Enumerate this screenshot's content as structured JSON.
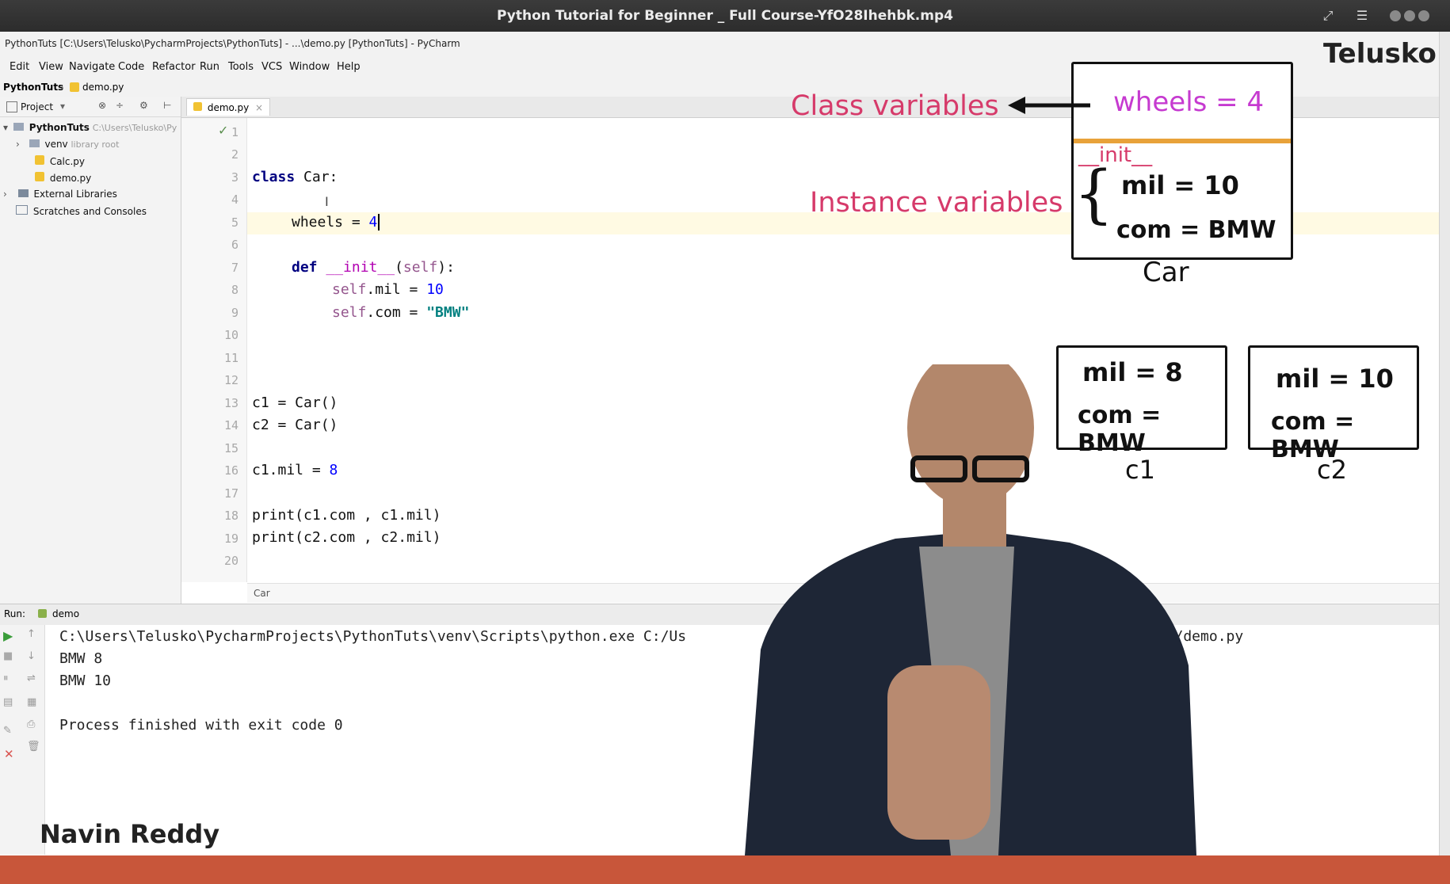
{
  "video": {
    "title": "Python Tutorial for Beginner _ Full Course-YfO28Ihehbk.mp4",
    "expand_icon": "expand-icon",
    "menu_icon": "hamburger-menu-icon"
  },
  "pycharm": {
    "window_title": "PythonTuts [C:\\Users\\Telusko\\PycharmProjects\\PythonTuts] - ...\\demo.py [PythonTuts] - PyCharm",
    "menu": [
      "Edit",
      "View",
      "Navigate",
      "Code",
      "Refactor",
      "Run",
      "Tools",
      "VCS",
      "Window",
      "Help"
    ],
    "breadcrumbs": [
      "PythonTuts",
      "demo.py"
    ],
    "project_label": "Project",
    "tree": {
      "root": "PythonTuts",
      "root_path": "C:\\Users\\Telusko\\Py",
      "venv": "venv",
      "venv_note": "library root",
      "files": [
        "Calc.py",
        "demo.py"
      ],
      "external": "External Libraries",
      "scratches": "Scratches and Consoles"
    },
    "editor_tab": "demo.py",
    "line_numbers": [
      "1",
      "2",
      "3",
      "4",
      "5",
      "6",
      "7",
      "8",
      "9",
      "10",
      "11",
      "12",
      "13",
      "14",
      "15",
      "16",
      "17",
      "18",
      "19",
      "20"
    ],
    "code": {
      "l3_kw": "class",
      "l3_rest": " Car:",
      "l5_a": "wheels = ",
      "l5_num": "4",
      "l7_kw": "def",
      "l7_fn": "__init__",
      "l7_p1": "(",
      "l7_self": "self",
      "l7_p2": "):",
      "l8_self": "self",
      "l8_rest": ".mil = ",
      "l8_num": "10",
      "l9_self": "self",
      "l9_rest": ".com = ",
      "l9_str": "\"BMW\"",
      "l13": "c1 = Car()",
      "l14": "c2 = Car()",
      "l16_a": "c1.mil = ",
      "l16_num": "8",
      "l18": "print(c1.com , c1.mil)",
      "l19": "print(c2.com , c2.mil)"
    },
    "editor_breadcrumb": "Car",
    "run": {
      "label": "Run:",
      "config": "demo",
      "lines": [
        "C:\\Users\\Telusko\\PycharmProjects\\PythonTuts\\venv\\Scripts\\python.exe C:/Us",
        "BMW 8",
        "BMW 10",
        "",
        "Process finished with exit code 0"
      ],
      "line1_tail": "uts/demo.py"
    }
  },
  "overlay": {
    "brand": "Telusko",
    "presenter": "Navin Reddy",
    "class_vars_label": "Class variables",
    "instance_vars_label": "Instance variables",
    "car_box": {
      "class_var": "wheels = 4",
      "init": "__init__",
      "mil": "mil  = 10",
      "com": "com = BMW",
      "caption": "Car"
    },
    "c1_box": {
      "mil": "mil  = 8",
      "com": "com = BMW",
      "caption": "c1"
    },
    "c2_box": {
      "mil": "mil  = 10",
      "com": "com = BMW",
      "caption": "c2"
    },
    "colors": {
      "pink": "#d63a6a",
      "magenta": "#c63ad0",
      "orange": "#e8a23a",
      "bottom_bar": "#c8563a"
    }
  }
}
